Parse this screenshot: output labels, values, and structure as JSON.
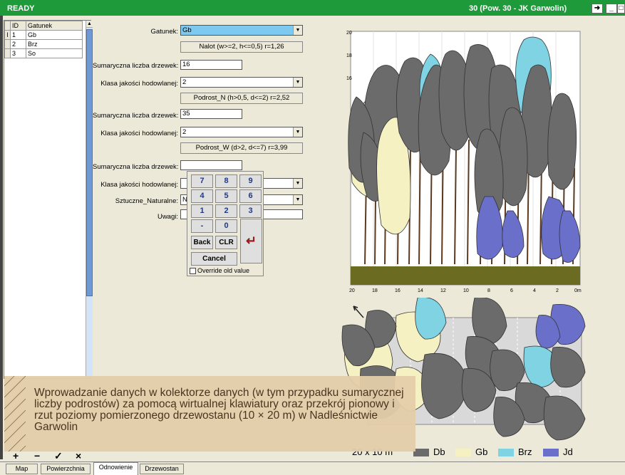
{
  "titlebar": {
    "status": "READY",
    "plot": "30 (Pow. 30 - JK Garwolin)"
  },
  "species_table": {
    "headers": [
      "ID",
      "Gatunek"
    ],
    "rows": [
      {
        "marker": "I",
        "id": "1",
        "gatunek": "Gb"
      },
      {
        "marker": "",
        "id": "2",
        "gatunek": "Brz"
      },
      {
        "marker": "",
        "id": "3",
        "gatunek": "So"
      }
    ]
  },
  "form": {
    "gatunek_label": "Gatunek:",
    "gatunek_value": "Gb",
    "nalot_button": "Nalot (w>=2, h<=0,5) r=1,26",
    "sum1_label": "Sumaryczna liczba drzewek:",
    "sum1_value": "16",
    "klasa1_label": "Klasa jakości hodowlanej:",
    "klasa1_value": "2",
    "podrost_n_button": "Podrost_N (h>0,5, d<=2) r=2,52",
    "sum2_label": "Sumaryczna liczba drzewek:",
    "sum2_value": "35",
    "klasa2_label": "Klasa jakości hodowlanej:",
    "klasa2_value": "2",
    "podrost_w_button": "Podrost_W (d>2, d<=7) r=3,99",
    "sum3_label": "Sumaryczna liczba drzewek:",
    "sum3_value": "",
    "klasa3_label": "Klasa jakości hodowlanej:",
    "sztuczne_label": "Sztuczne_Naturalne:",
    "sztuczne_value": "Na",
    "uwagi_label": "Uwagi:"
  },
  "keypad": {
    "keys": [
      "7",
      "8",
      "9",
      "4",
      "5",
      "6",
      "1",
      "2",
      "3",
      "-",
      "0"
    ],
    "back": "Back",
    "clr": "CLR",
    "cancel": "Cancel",
    "enter": "↵",
    "override": "Override old value"
  },
  "profile": {
    "y_ticks": [
      "20",
      "18",
      "16"
    ],
    "x_ticks": [
      "20",
      "18",
      "16",
      "14",
      "12",
      "10",
      "8",
      "6",
      "4",
      "2",
      "0m"
    ]
  },
  "plan": {
    "scale_label": "20 x 10 m"
  },
  "legend": [
    {
      "label": "Db",
      "color": "#6b6b6b"
    },
    {
      "label": "Gb",
      "color": "#f5f1c3"
    },
    {
      "label": "Brz",
      "color": "#7fd3e3"
    },
    {
      "label": "Jd",
      "color": "#6a6fc9"
    }
  ],
  "caption": "Wprowadzanie danych w kolektorze danych (w tym przypadku sumarycznej liczby podrostów) za pomocą wirtualnej klawiatury oraz przekrój pionowy i rzut poziomy pomierzonego drzewostanu  (10 × 20 m) w Nadleśnictwie Garwolin",
  "toolbar": {
    "add": "+",
    "remove": "−",
    "ok": "✓",
    "close": "×"
  },
  "tabs": [
    "Map",
    "Powierzchnia",
    "Odnowienie",
    "Drzewostan"
  ],
  "colors": {
    "titlebar": "#1f9a3a",
    "caption_bg": "#e4cdaa",
    "ground": "#6b6b22"
  }
}
